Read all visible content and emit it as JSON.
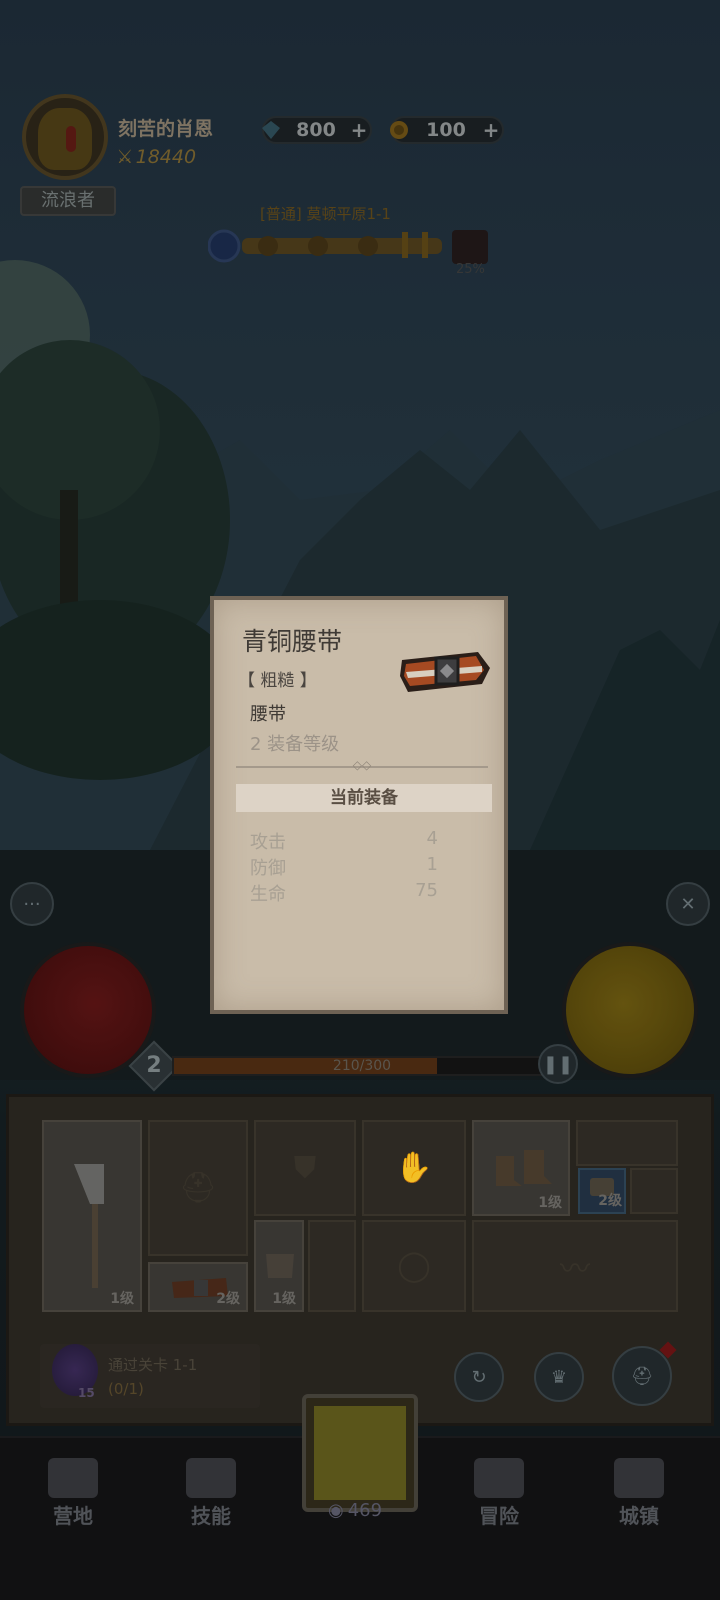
{
  "player": {
    "name": "刻苦的肖恩",
    "power": "18440",
    "title": "流浪者"
  },
  "resources": [
    {
      "icon": "gem-icon",
      "value": "800"
    },
    {
      "icon": "coin-icon",
      "value": "100"
    }
  ],
  "stage": {
    "label": "[普通] 莫顿平原1-1",
    "boss_progress": "25%"
  },
  "level": {
    "number": "2",
    "xp_text": "210/300",
    "xp_fraction": 0.7
  },
  "tooltip": {
    "name": "青铜腰带",
    "quality": "【 粗糙 】",
    "type": "腰带",
    "requirement": "2 装备等级",
    "section_title": "当前装备",
    "stats": [
      {
        "name": "攻击",
        "value": "4"
      },
      {
        "name": "防御",
        "value": "1"
      },
      {
        "name": "生命",
        "value": "75"
      }
    ]
  },
  "inventory": {
    "slots": [
      {
        "item": "axe",
        "level": "1级"
      },
      {
        "item": "belt",
        "level": "2级"
      },
      {
        "item": "chest",
        "level": "1级"
      },
      {
        "item": "boots",
        "level": "1级"
      },
      {
        "item": "scroll",
        "level": "2级"
      }
    ]
  },
  "quest": {
    "text": "通过关卡 1-1",
    "progress": "(0/1)",
    "count": "15"
  },
  "nav": {
    "items": [
      "营地",
      "技能",
      "冒险",
      "城镇"
    ],
    "center_count": "469"
  },
  "colors": {
    "card_bg": "#c9bca9",
    "xp_fill": "#4d2c12",
    "hp": "#5a1414",
    "mp": "#6a5810"
  }
}
